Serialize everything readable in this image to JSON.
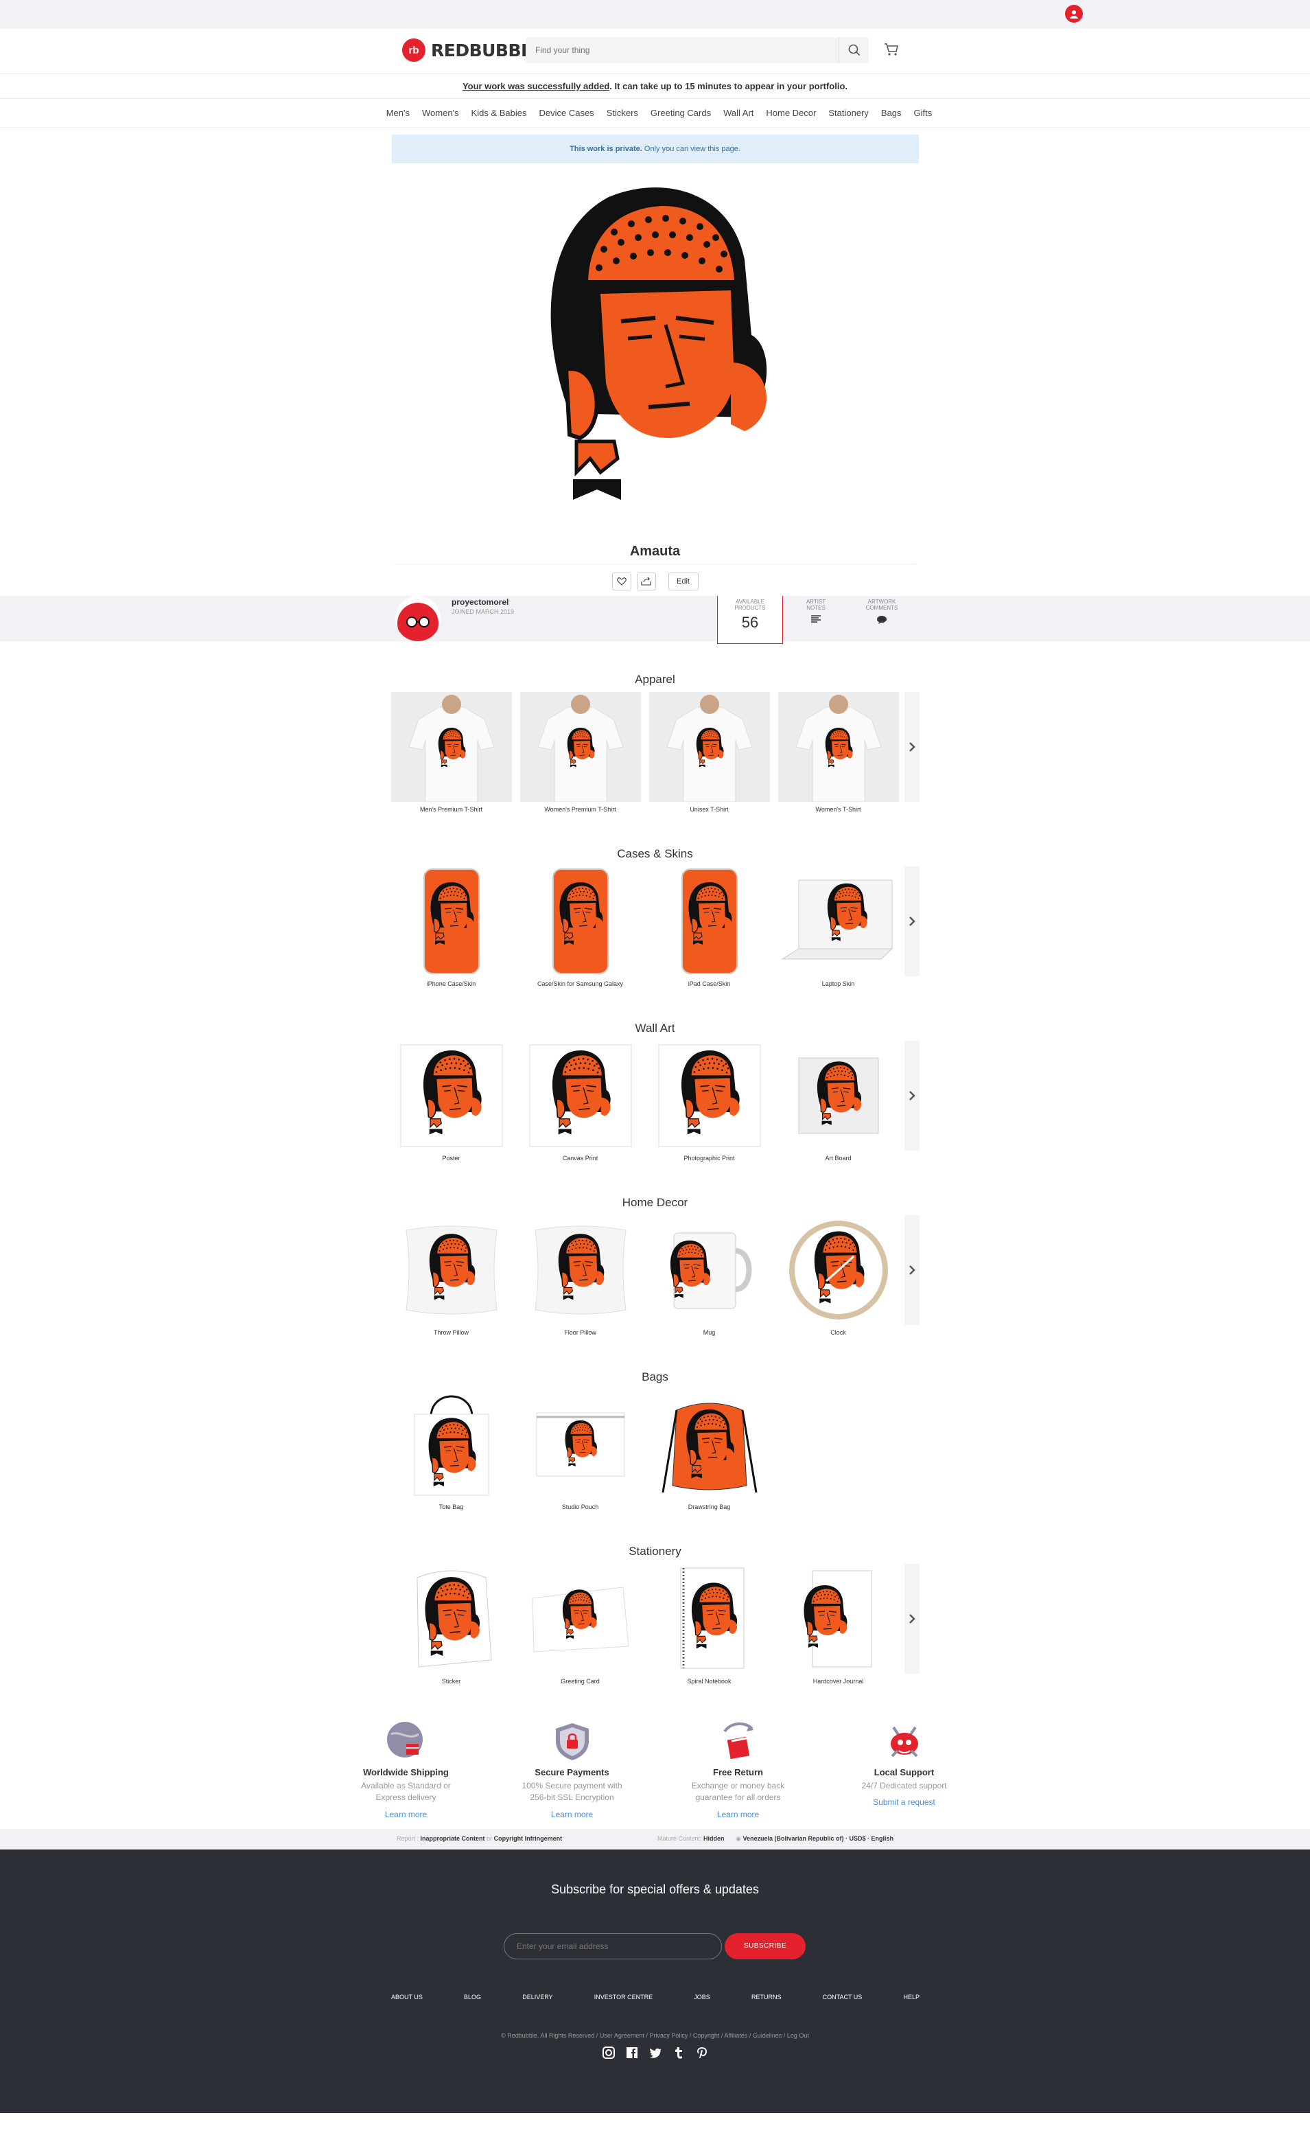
{
  "header": {
    "logo_text": "REDBUBBLE",
    "logo_mark": "rb",
    "search_placeholder": "Find your thing"
  },
  "notice": {
    "link_text": "Your work was successfully added",
    "rest_text": ". It can take up to 15 minutes to appear in your portfolio."
  },
  "nav": [
    "Men's",
    "Women's",
    "Kids & Babies",
    "Device Cases",
    "Stickers",
    "Greeting Cards",
    "Wall Art",
    "Home Decor",
    "Stationery",
    "Bags",
    "Gifts"
  ],
  "private_notice": {
    "bold": "This work is private.",
    "rest": " Only you can view this page."
  },
  "artwork": {
    "title": "Amauta",
    "edit_label": "Edit"
  },
  "artist": {
    "name": "proyectomorel",
    "joined": "JOINED MARCH 2019",
    "stats": [
      {
        "label_1": "AVAILABLE",
        "label_2": "PRODUCTS",
        "value": "56"
      },
      {
        "label_1": "ARTIST",
        "label_2": "NOTES",
        "value": ""
      },
      {
        "label_1": "ARTWORK",
        "label_2": "COMMENTS",
        "value": ""
      }
    ]
  },
  "sections": [
    {
      "title": "Apparel",
      "items": [
        "Men's Premium T-Shirt",
        "Women's Premium T-Shirt",
        "Unisex T-Shirt",
        "Women's T-Shirt"
      ]
    },
    {
      "title": "Cases & Skins",
      "items": [
        "iPhone Case/Skin",
        "Case/Skin for Samsung Galaxy",
        "iPad Case/Skin",
        "Laptop Skin"
      ]
    },
    {
      "title": "Wall Art",
      "items": [
        "Poster",
        "Canvas Print",
        "Photographic Print",
        "Art Board"
      ]
    },
    {
      "title": "Home Decor",
      "items": [
        "Throw Pillow",
        "Floor Pillow",
        "Mug",
        "Clock"
      ]
    },
    {
      "title": "Bags",
      "items": [
        "Tote Bag",
        "Studio Pouch",
        "Drawstring Bag"
      ]
    },
    {
      "title": "Stationery",
      "items": [
        "Sticker",
        "Greeting Card",
        "Spiral Notebook",
        "Hardcover Journal"
      ]
    }
  ],
  "features": [
    {
      "title": "Worldwide Shipping",
      "text": "Available as Standard or Express delivery",
      "link": "Learn more"
    },
    {
      "title": "Secure Payments",
      "text": "100% Secure payment with 256-bit SSL Encryption",
      "link": "Learn more"
    },
    {
      "title": "Free Return",
      "text": "Exchange or money back guarantee for all orders",
      "link": "Learn more"
    },
    {
      "title": "Local Support",
      "text": "24/7 Dedicated support",
      "link": "Submit a request"
    }
  ],
  "report": {
    "label": "Report",
    "inappropriate": "Inappropriate Content",
    "sep": " or ",
    "copyright": "Copyright Infringement",
    "mature_label": "Mature Content: ",
    "mature_value": "Hidden",
    "locale": "Venezuela (Bolivarian Republic of) · USD$ · English"
  },
  "footer": {
    "subscribe_title": "Subscribe for special offers & updates",
    "email_placeholder": "Enter your email address",
    "subscribe_button": "SUBSCRIBE",
    "links": [
      "ABOUT US",
      "BLOG",
      "DELIVERY",
      "INVESTOR CENTRE",
      "JOBS",
      "RETURNS",
      "CONTACT US",
      "HELP"
    ],
    "legal": "© Redbubble. All Rights Reserved  /  User Agreement  /  Privacy Policy  /  Copyright  /  Affiliates  /  Guidelines  /  Log Out"
  },
  "colors": {
    "brand_red": "#e4222d",
    "artwork_orange": "#f05a1e",
    "footer_bg": "#2d2f36",
    "link_blue": "#4a90d9"
  }
}
